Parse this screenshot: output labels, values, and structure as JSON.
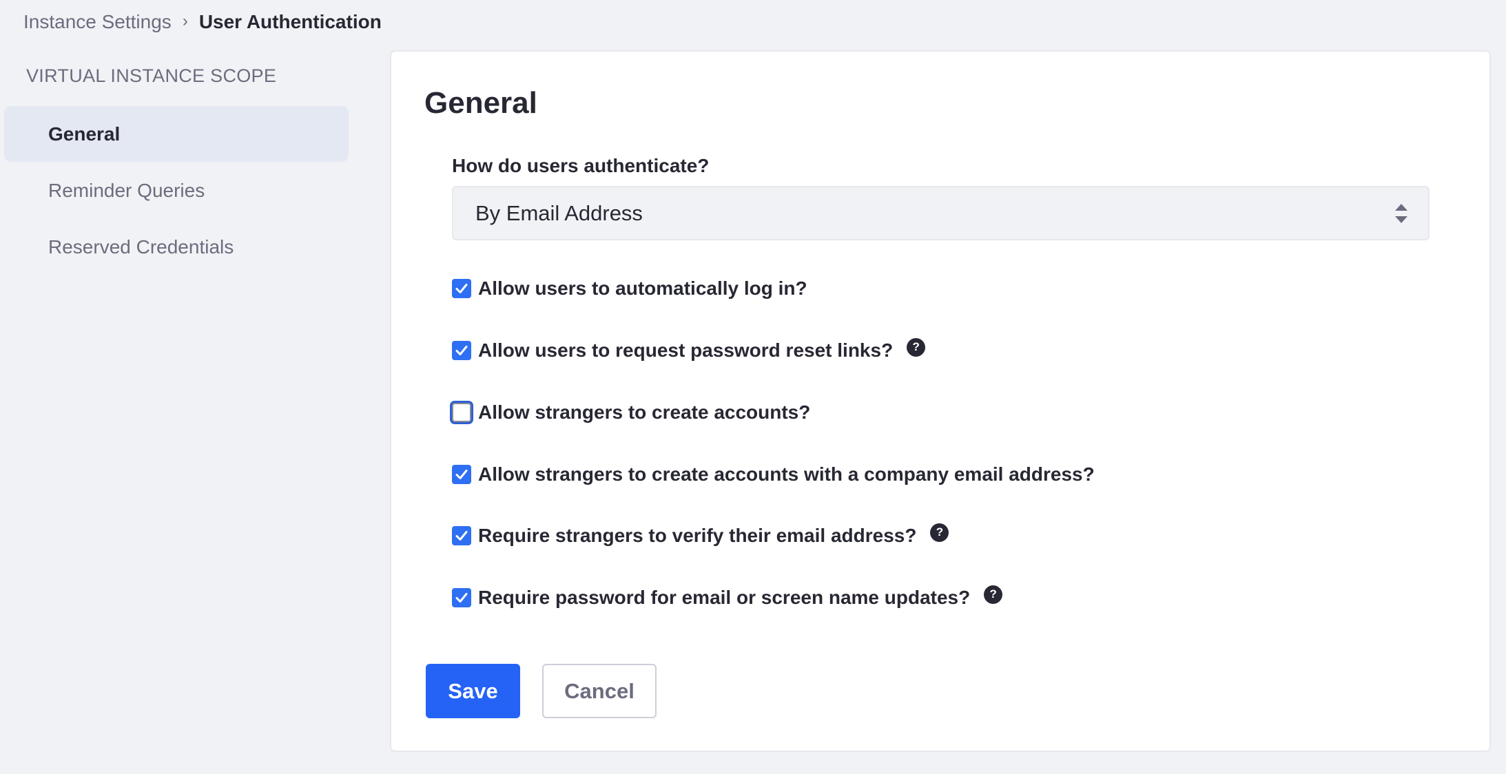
{
  "breadcrumb": {
    "parent": "Instance Settings",
    "separator": "›",
    "current": "User Authentication"
  },
  "sidebar": {
    "heading": "VIRTUAL INSTANCE SCOPE",
    "items": [
      {
        "label": "General",
        "active": true
      },
      {
        "label": "Reminder Queries",
        "active": false
      },
      {
        "label": "Reserved Credentials",
        "active": false
      }
    ]
  },
  "main": {
    "title": "General",
    "auth_field": {
      "label": "How do users authenticate?",
      "value": "By Email Address",
      "icon": "select-caret-icon"
    },
    "options": [
      {
        "label": "Allow users to automatically log in?",
        "checked": true,
        "help": false
      },
      {
        "label": "Allow users to request password reset links?",
        "checked": true,
        "help": true
      },
      {
        "label": "Allow strangers to create accounts?",
        "checked": false,
        "help": false,
        "focused": true
      },
      {
        "label": "Allow strangers to create accounts with a company email address?",
        "checked": true,
        "help": false
      },
      {
        "label": "Require strangers to verify their email address?",
        "checked": true,
        "help": true
      },
      {
        "label": "Require password for email or screen name updates?",
        "checked": true,
        "help": true
      }
    ],
    "help_glyph": "?",
    "save_label": "Save",
    "cancel_label": "Cancel"
  },
  "colors": {
    "primary": "#2463f5",
    "checkbox": "#2e6ff3",
    "text": "#272833",
    "muted": "#6b6c7e",
    "background": "#f1f2f5",
    "active_nav": "#e4e8f3"
  }
}
